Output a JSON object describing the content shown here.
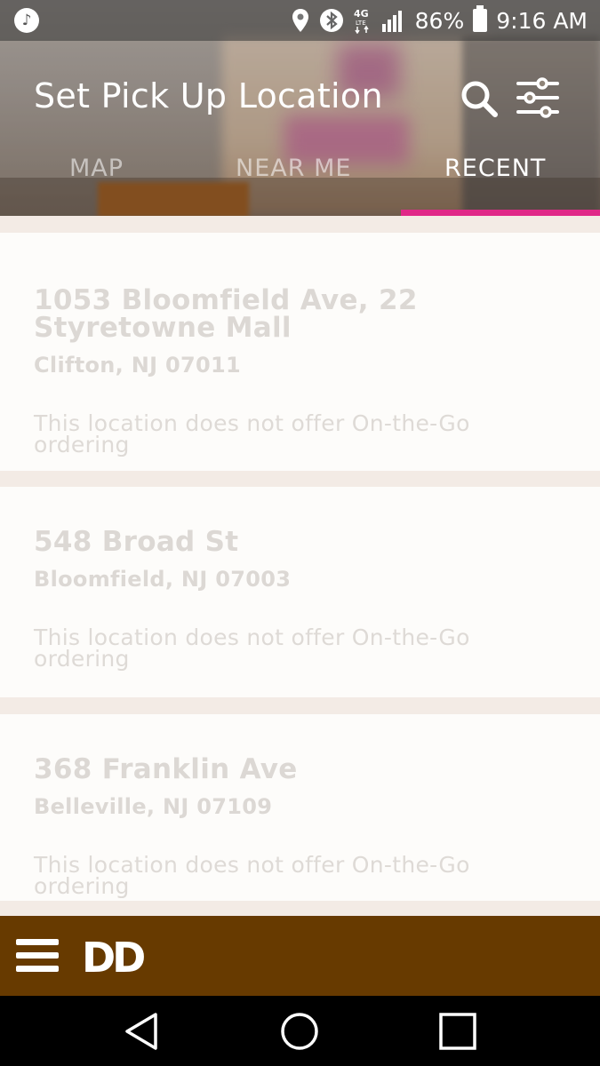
{
  "status_bar": {
    "battery_percent": "86%",
    "time": "9:16 AM",
    "network": "4G LTE",
    "icons": [
      "music-icon",
      "location-icon",
      "bluetooth-icon",
      "signal-icon",
      "battery-icon"
    ]
  },
  "header": {
    "title": "Set Pick Up Location",
    "actions": [
      "search-icon",
      "filter-sliders-icon"
    ]
  },
  "tabs": [
    {
      "label": "MAP",
      "active": false
    },
    {
      "label": "NEAR ME",
      "active": false
    },
    {
      "label": "RECENT",
      "active": true
    }
  ],
  "colors": {
    "tab_indicator": "#e02888",
    "app_bar": "#673a00",
    "card_bg": "#fdfcfa",
    "list_bg": "#f3ebe5",
    "card_text": "#dcd8d4"
  },
  "locations": [
    {
      "street": "1053 Bloomfield Ave, 22 Styretowne Mall",
      "city": "Clifton, NJ 07011",
      "note": "This location does not offer On-the-Go ordering"
    },
    {
      "street": "548 Broad St",
      "city": "Bloomfield, NJ 07003",
      "note": "This location does not offer On-the-Go ordering"
    },
    {
      "street": "368 Franklin Ave",
      "city": "Belleville, NJ 07109",
      "note": "This location does not offer On-the-Go ordering"
    }
  ],
  "app_bar": {
    "logo": "DD",
    "menu_icon": "hamburger-menu-icon"
  },
  "nav_bar": {
    "buttons": [
      "back-icon",
      "home-icon",
      "recent-apps-icon"
    ]
  }
}
